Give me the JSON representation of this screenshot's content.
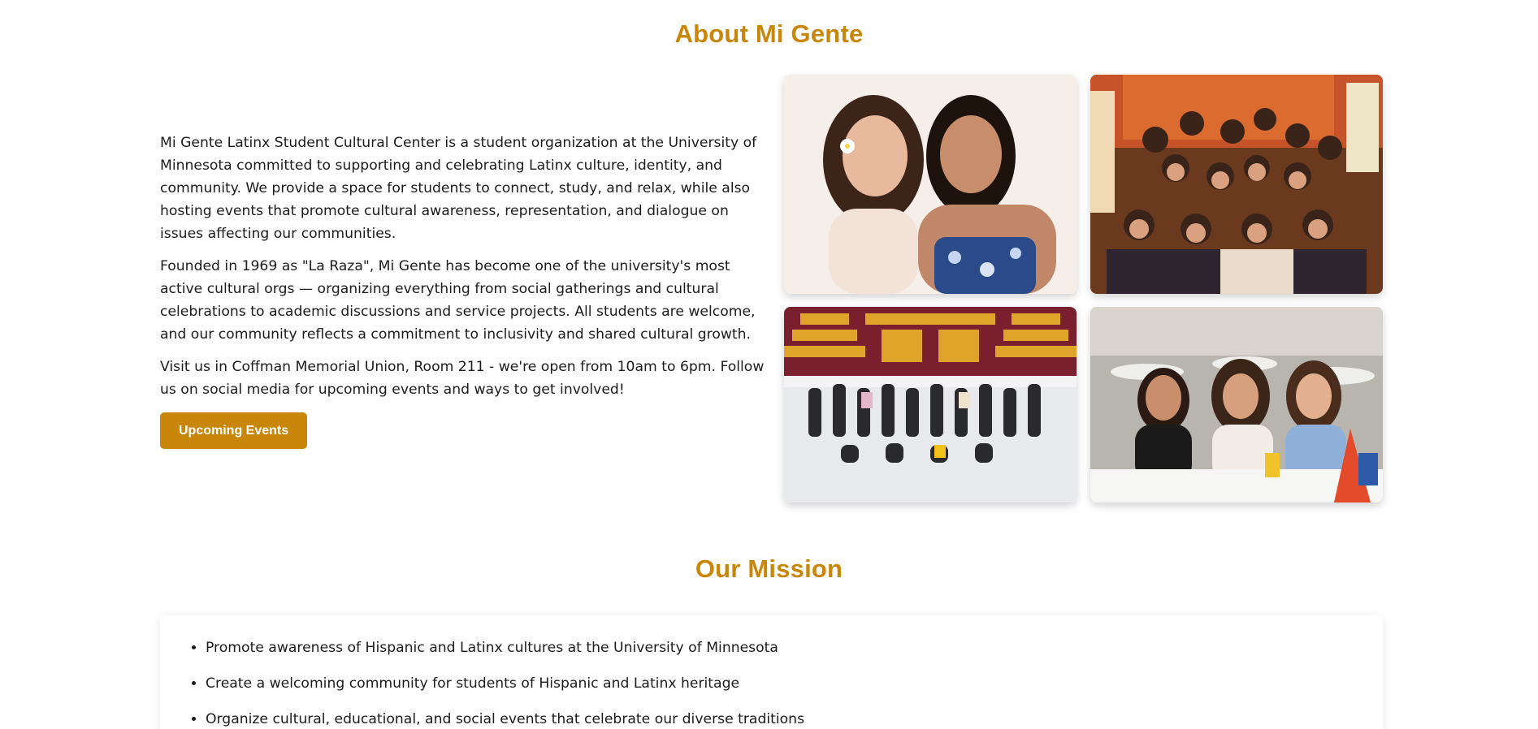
{
  "about": {
    "title": "About Mi Gente",
    "paragraphs": [
      "Mi Gente Latinx Student Cultural Center is a student organization at the University of Minnesota committed to supporting and celebrating Latinx culture, identity, and community. We provide a space for students to connect, study, and relax, while also hosting events that promote cultural awareness, representation, and dialogue on issues affecting our communities.",
      "Founded in 1969 as \"La Raza\", Mi Gente has become one of the university's most active cultural orgs — organizing everything from social gatherings and cultural celebrations to academic discussions and service projects. All students are welcome, and our community reflects a commitment to inclusivity and shared cultural growth.",
      "Visit us in Coffman Memorial Union, Room 211 - we're open from 10am to 6pm. Follow us on social media for upcoming events and ways to get involved!"
    ],
    "button_label": "Upcoming Events",
    "photos": [
      {
        "name": "photo-two-students-portrait"
      },
      {
        "name": "photo-group-indoor-party"
      },
      {
        "name": "photo-group-ice-rink"
      },
      {
        "name": "photo-students-at-dinner-table"
      }
    ]
  },
  "mission": {
    "title": "Our Mission",
    "items": [
      "Promote awareness of Hispanic and Latinx cultures at the University of Minnesota",
      "Create a welcoming community for students of Hispanic and Latinx heritage",
      "Organize cultural, educational, and social events that celebrate our diverse traditions"
    ]
  },
  "colors": {
    "accent": "#c8860a",
    "text": "#1c1c1c",
    "background": "#ffffff"
  }
}
